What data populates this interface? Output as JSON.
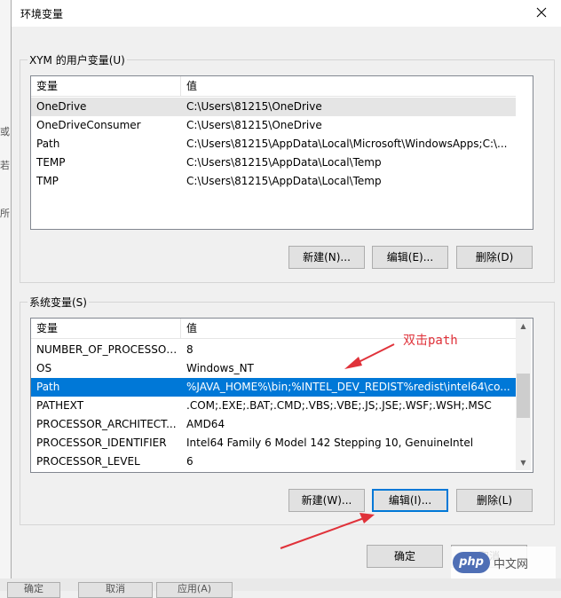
{
  "window": {
    "title": "环境变量",
    "close_glyph": "✕"
  },
  "background": {
    "buttons": [
      "确定",
      "取消",
      "应用(A)"
    ],
    "side_chars": [
      "或",
      "若",
      "所"
    ]
  },
  "user_vars": {
    "group_label": "XYM 的用户变量(U)",
    "columns": [
      "变量",
      "值"
    ],
    "rows": [
      {
        "name": "OneDrive",
        "value": "C:\\Users\\81215\\OneDrive"
      },
      {
        "name": "OneDriveConsumer",
        "value": "C:\\Users\\81215\\OneDrive"
      },
      {
        "name": "Path",
        "value": "C:\\Users\\81215\\AppData\\Local\\Microsoft\\WindowsApps;C:\\..."
      },
      {
        "name": "TEMP",
        "value": "C:\\Users\\81215\\AppData\\Local\\Temp"
      },
      {
        "name": "TMP",
        "value": "C:\\Users\\81215\\AppData\\Local\\Temp"
      }
    ],
    "buttons": {
      "new": "新建(N)...",
      "edit": "编辑(E)...",
      "delete": "删除(D)"
    }
  },
  "system_vars": {
    "group_label": "系统变量(S)",
    "columns": [
      "变量",
      "值"
    ],
    "rows": [
      {
        "name": "NUMBER_OF_PROCESSORS",
        "value": "8"
      },
      {
        "name": "OS",
        "value": "Windows_NT"
      },
      {
        "name": "Path",
        "value": "%JAVA_HOME%\\bin;%INTEL_DEV_REDIST%redist\\intel64\\co..."
      },
      {
        "name": "PATHEXT",
        "value": ".COM;.EXE;.BAT;.CMD;.VBS;.VBE;.JS;.JSE;.WSF;.WSH;.MSC"
      },
      {
        "name": "PROCESSOR_ARCHITECT...",
        "value": "AMD64"
      },
      {
        "name": "PROCESSOR_IDENTIFIER",
        "value": "Intel64 Family 6 Model 142 Stepping 10, GenuineIntel"
      },
      {
        "name": "PROCESSOR_LEVEL",
        "value": "6"
      }
    ],
    "selected_index": 2,
    "buttons": {
      "new": "新建(W)...",
      "edit": "编辑(I)...",
      "delete": "删除(L)"
    }
  },
  "footer": {
    "ok": "确定",
    "cancel": "取消"
  },
  "annotation": {
    "text": "双击path",
    "color": "#e0323a"
  },
  "watermark": {
    "logo": "php",
    "text": "中文网"
  },
  "colors": {
    "selection": "#0078d7",
    "hover": "#e5e5e5",
    "dialog_bg": "#f0f0f0"
  }
}
